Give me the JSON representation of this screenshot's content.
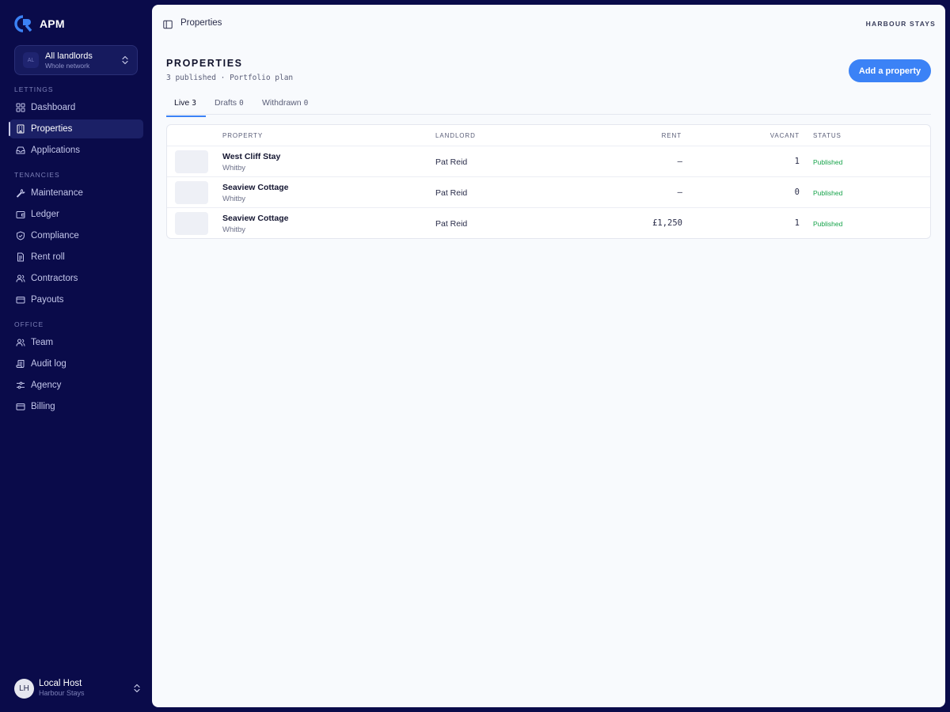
{
  "brand": {
    "name": "APM"
  },
  "switcher": {
    "avatar": "AL",
    "title": "All landlords",
    "subtitle": "Whole network"
  },
  "sidebar": {
    "sections": [
      {
        "label": "LETTINGS",
        "items": [
          {
            "label": "Dashboard",
            "icon": "grid-icon",
            "active": false
          },
          {
            "label": "Properties",
            "icon": "building-icon",
            "active": true
          },
          {
            "label": "Applications",
            "icon": "inbox-icon",
            "active": false
          }
        ]
      },
      {
        "label": "TENANCIES",
        "items": [
          {
            "label": "Maintenance",
            "icon": "wrench-icon",
            "active": false
          },
          {
            "label": "Ledger",
            "icon": "wallet-icon",
            "active": false
          },
          {
            "label": "Compliance",
            "icon": "shield-icon",
            "active": false
          },
          {
            "label": "Rent roll",
            "icon": "document-icon",
            "active": false
          },
          {
            "label": "Contractors",
            "icon": "users-icon",
            "active": false
          },
          {
            "label": "Payouts",
            "icon": "card-icon",
            "active": false
          }
        ]
      },
      {
        "label": "OFFICE",
        "items": [
          {
            "label": "Team",
            "icon": "users-icon",
            "active": false
          },
          {
            "label": "Audit log",
            "icon": "scroll-icon",
            "active": false
          },
          {
            "label": "Agency",
            "icon": "sliders-icon",
            "active": false
          },
          {
            "label": "Billing",
            "icon": "card-icon",
            "active": false
          }
        ]
      }
    ]
  },
  "user": {
    "initials": "LH",
    "name": "Local Host",
    "org": "Harbour Stays"
  },
  "header": {
    "breadcrumb": "Properties",
    "org": "HARBOUR STAYS"
  },
  "page": {
    "title": "PROPERTIES",
    "subtitle": "3 published · Portfolio plan",
    "add_button": "Add a property"
  },
  "tabs": [
    {
      "label": "Live",
      "count": "3",
      "active": true
    },
    {
      "label": "Drafts",
      "count": "0",
      "active": false
    },
    {
      "label": "Withdrawn",
      "count": "0",
      "active": false
    }
  ],
  "table": {
    "columns": {
      "property": "PROPERTY",
      "landlord": "LANDLORD",
      "rent": "RENT",
      "vacant": "VACANT",
      "status": "STATUS"
    },
    "rows": [
      {
        "name": "West Cliff Stay",
        "location": "Whitby",
        "landlord": "Pat Reid",
        "rent": "—",
        "vacant": "1",
        "status": "Published"
      },
      {
        "name": "Seaview Cottage",
        "location": "Whitby",
        "landlord": "Pat Reid",
        "rent": "—",
        "vacant": "0",
        "status": "Published"
      },
      {
        "name": "Seaview Cottage",
        "location": "Whitby",
        "landlord": "Pat Reid",
        "rent": "£1,250",
        "vacant": "1",
        "status": "Published"
      }
    ]
  },
  "colors": {
    "accent": "#3b82f6",
    "sidebar": "#0a0b4a",
    "status_published": "#16a34a"
  }
}
